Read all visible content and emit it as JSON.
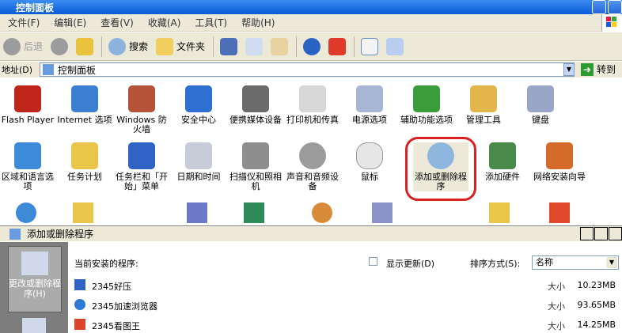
{
  "window": {
    "title": "控制面板"
  },
  "menu": [
    "文件(F)",
    "编辑(E)",
    "查看(V)",
    "收藏(A)",
    "工具(T)",
    "帮助(H)"
  ],
  "toolbar": {
    "back": "后退",
    "search": "搜索",
    "folders": "文件夹"
  },
  "address": {
    "label": "地址(D)",
    "value": "控制面板",
    "go": "转到"
  },
  "grid": {
    "row1": [
      "Flash Player",
      "Internet 选项",
      "Windows 防火墙",
      "安全中心",
      "便携媒体设备",
      "打印机和传真",
      "电源选项",
      "辅助功能选项",
      "管理工具",
      "键盘"
    ],
    "row2": [
      "区域和语言选项",
      "任务计划",
      "任务栏和「开始」菜单",
      "日期和时间",
      "扫描仪和照相机",
      "声音和音频设备",
      "鼠标",
      "添加或删除程序",
      "添加硬件",
      "网络安装向导"
    ]
  },
  "dialog": {
    "title": "添加或删除程序",
    "side_button": "更改或删除程序(H)",
    "installed_label": "当前安装的程序:",
    "show_updates": "显示更新(D)",
    "sort_label": "排序方式(S):",
    "sort_value": "名称",
    "programs": [
      {
        "name": "2345好压",
        "size_label": "大小",
        "size": "10.23MB"
      },
      {
        "name": "2345加速浏览器",
        "size_label": "大小",
        "size": "93.65MB"
      },
      {
        "name": "2345看图王",
        "size_label": "大小",
        "size": "14.25MB"
      }
    ]
  },
  "colors": {
    "xp_blue": "#0a5bd6",
    "highlight_red": "#d9221f",
    "panel_bg": "#ece9d8"
  }
}
